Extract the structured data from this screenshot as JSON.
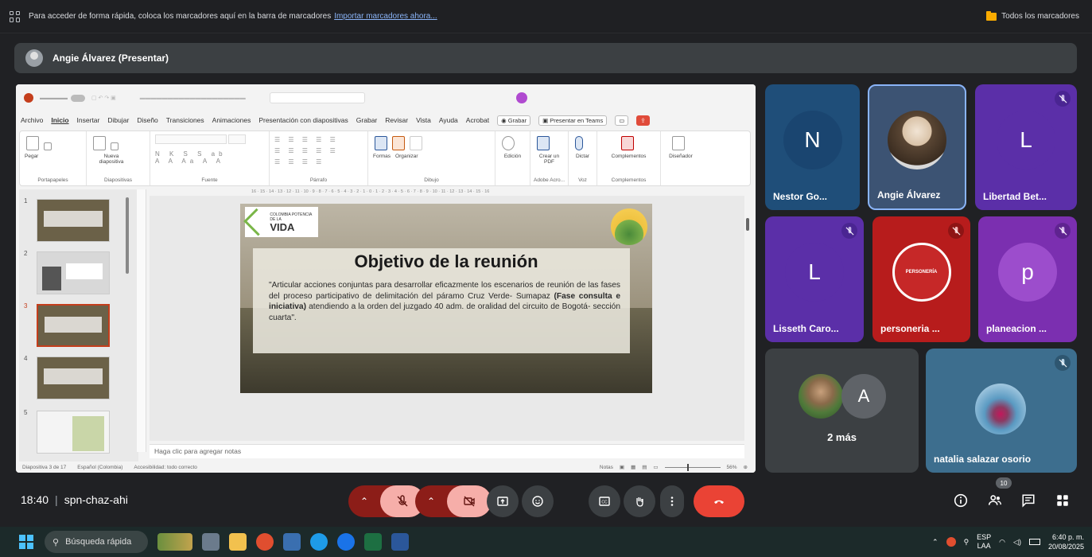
{
  "bookmarks_bar": {
    "message": "Para acceder de forma rápida, coloca los marcadores aquí en la barra de marcadores",
    "import_link": "Importar marcadores ahora...",
    "all_bookmarks": "Todos los marcadores"
  },
  "presenter_banner": {
    "label": "Angie Álvarez (Presentar)"
  },
  "powerpoint": {
    "menu": [
      "Archivo",
      "Inicio",
      "Insertar",
      "Dibujar",
      "Diseño",
      "Transiciones",
      "Animaciones",
      "Presentación con diapositivas",
      "Grabar",
      "Revisar",
      "Vista",
      "Ayuda",
      "Acrobat"
    ],
    "active_menu": "Inicio",
    "record_button": "Grabar",
    "present_teams_button": "Presentar en Teams",
    "ribbon_groups": [
      "Portapapeles",
      "Diapositivas",
      "Fuente",
      "Párrafo",
      "Dibujo",
      "Adobe Acro...",
      "Voz",
      "Complementos"
    ],
    "ribbon_labels": {
      "paste": "Pegar",
      "new_slide": "Nueva diapositiva",
      "shapes": "Formas",
      "arrange": "Organizar",
      "editing": "Edición",
      "create_pdf": "Crear un PDF",
      "dictate": "Dictar",
      "addins": "Complementos",
      "designer": "Diseñador"
    },
    "slide_numbers": [
      "1",
      "2",
      "3",
      "4",
      "5"
    ],
    "selected_slide": "3",
    "notes_placeholder": "Haga clic para agregar notas",
    "status": {
      "slide_counter": "Diapositiva 3 de 17",
      "language": "Español (Colombia)",
      "accessibility": "Accesibilidad: todo correcto",
      "notes": "Notas",
      "zoom": "56%"
    },
    "slide": {
      "logo_small": "COLOMBIA POTENCIA DE LA",
      "logo_big": "VIDA",
      "title": "Objetivo de la reunión",
      "body_1": "\"Articular acciones conjuntas para desarrollar eficazmente los escenarios de reunión de las fases del proceso participativo de delimitación del páramo Cruz Verde- Sumapaz ",
      "body_bold": "(Fase consulta e iniciativa)",
      "body_2": " atendiendo a la orden del juzgado 40 adm. de oralidad del circuito de Bogotá- sección cuarta\"."
    }
  },
  "participants": [
    {
      "letter": "N",
      "name": "Nestor Go...",
      "color": "#1f4e79",
      "muted": false
    },
    {
      "letter": "",
      "name": "Angie Álvarez",
      "color": "#3c5373",
      "muted": false,
      "active_speaker": true
    },
    {
      "letter": "L",
      "name": "Libertad Bet...",
      "color": "#5b2fa8",
      "muted": true
    },
    {
      "letter": "L",
      "name": "Lisseth Caro...",
      "color": "#5b2fa8",
      "muted": true
    },
    {
      "letter": "",
      "name": "personeria ...",
      "color": "#b71c1c",
      "muted": true,
      "logo_text": "PERSONERÍA"
    },
    {
      "letter": "p",
      "name": "planeacion ...",
      "color": "#7b2fb0",
      "muted": true
    },
    {
      "letter": "A",
      "name": "2 más",
      "color": "#3c4043",
      "muted": false
    },
    {
      "letter": "",
      "name": "natalia salazar osorio",
      "color": "#3d6e8e",
      "muted": true
    }
  ],
  "meeting": {
    "time": "18:40",
    "code": "spn-chaz-ahi",
    "participant_count": "10"
  },
  "taskbar": {
    "search_placeholder": "Búsqueda rápida",
    "lang_1": "ESP",
    "lang_2": "LAA",
    "time": "6:40 p. m.",
    "date": "20/08/2025"
  },
  "colors": {
    "end_call": "#ea4335",
    "mic_off_bg": "#f6aea9",
    "mic_chevron_bg": "#8c1d18",
    "ppt_accent": "#c43e1c",
    "meet_bg": "#202124"
  }
}
